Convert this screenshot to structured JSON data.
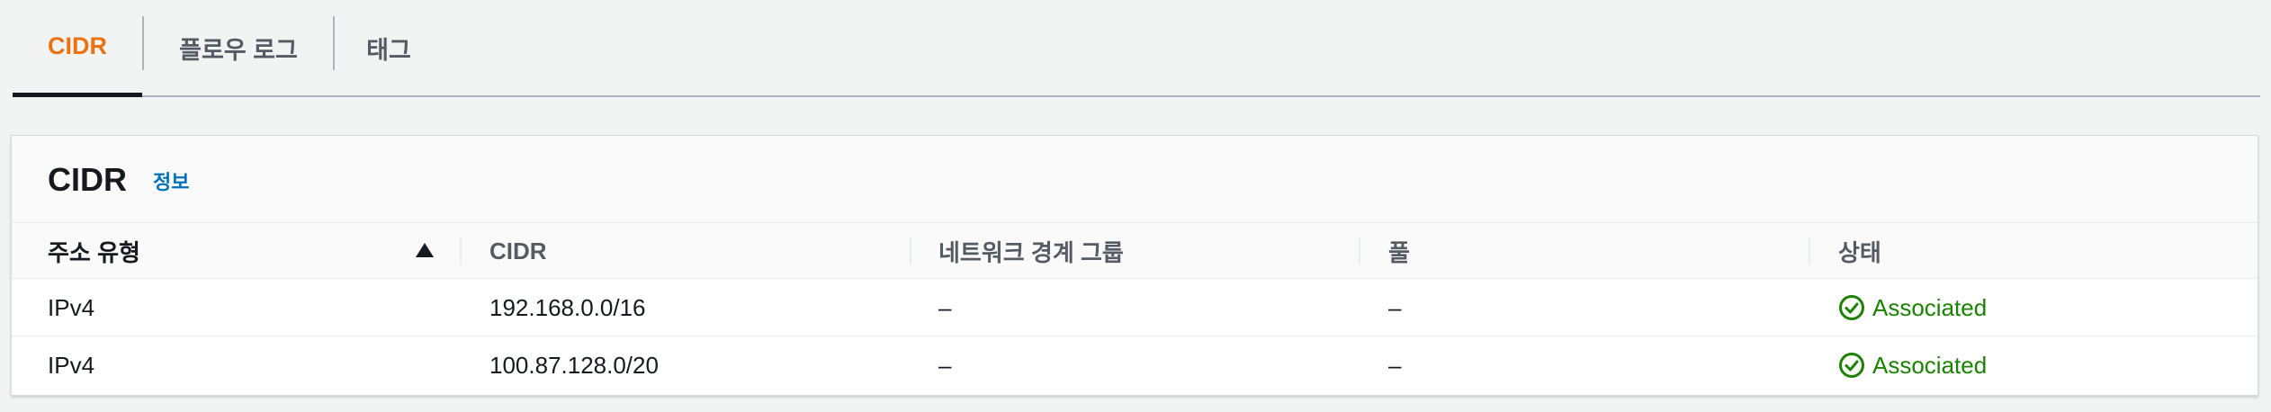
{
  "tabs": [
    {
      "label": "CIDR",
      "active": true
    },
    {
      "label": "플로우 로그",
      "active": false
    },
    {
      "label": "태그",
      "active": false
    }
  ],
  "panel": {
    "title": "CIDR",
    "info_link": "정보"
  },
  "table": {
    "columns": [
      "주소 유형",
      "CIDR",
      "네트워크 경계 그룹",
      "풀",
      "상태"
    ],
    "sort": {
      "column": "주소 유형",
      "direction": "ascending",
      "icon": "sort-ascending-icon"
    },
    "rows": [
      {
        "address_type": "IPv4",
        "cidr": "192.168.0.0/16",
        "network_border_group": "–",
        "pool": "–",
        "status": "Associated",
        "status_icon": "check-circle-icon"
      },
      {
        "address_type": "IPv4",
        "cidr": "100.87.128.0/20",
        "network_border_group": "–",
        "pool": "–",
        "status": "Associated",
        "status_icon": "check-circle-icon"
      }
    ]
  },
  "colors": {
    "active_tab": "#ec7211",
    "link": "#0073bb",
    "success": "#1d8102",
    "text": "#16191f",
    "muted_text": "#545b64"
  }
}
